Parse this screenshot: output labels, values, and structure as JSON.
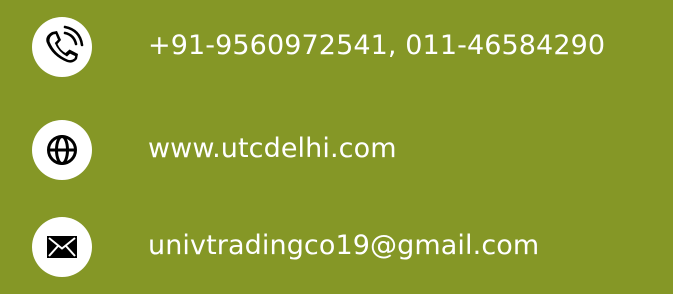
{
  "theme": {
    "background": "#859726",
    "icon_bg": "#ffffff",
    "icon_fg": "#000000",
    "text_color": "#ffffff"
  },
  "contacts": [
    {
      "icon": "phone-icon",
      "text": "+91-9560972541, 011-46584290"
    },
    {
      "icon": "globe-icon",
      "text": "www.utcdelhi.com"
    },
    {
      "icon": "envelope-icon",
      "text": "univtradingco19@gmail.com"
    }
  ]
}
